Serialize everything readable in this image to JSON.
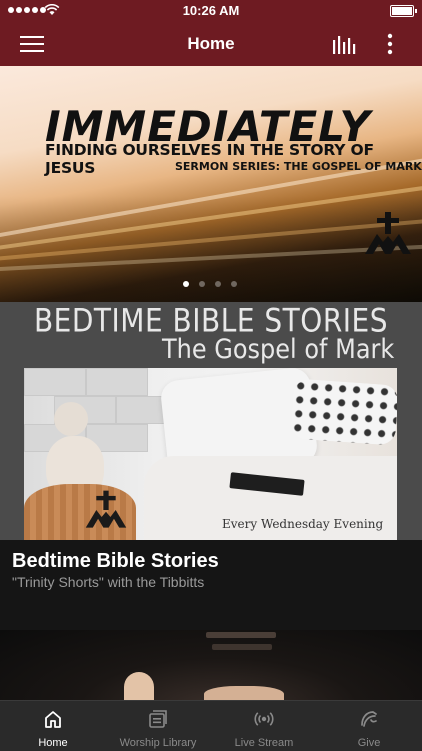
{
  "status_bar": {
    "time": "10:26 AM"
  },
  "nav": {
    "title": "Home"
  },
  "hero": {
    "title": "IMMEDIATELY",
    "subtitle": "FINDING OURSELVES IN THE STORY OF JESUS",
    "series": "SERMON SERIES:  THE GOSPEL OF MARK",
    "page_count": 4,
    "active_page": 1
  },
  "card": {
    "banner_line1": "BEDTIME BIBLE STORIES",
    "banner_line2": "The Gospel of Mark",
    "photo_caption": "Every Wednesday Evening",
    "title": "Bedtime Bible Stories",
    "subtitle": "\"Trinity Shorts\" with the Tibbitts"
  },
  "tabs": [
    {
      "label": "Home",
      "icon": "home-icon",
      "active": true
    },
    {
      "label": "Worship Library",
      "icon": "library-icon",
      "active": false
    },
    {
      "label": "Live Stream",
      "icon": "broadcast-icon",
      "active": false
    },
    {
      "label": "Give",
      "icon": "give-icon",
      "active": false
    }
  ],
  "colors": {
    "brand": "#6e1b22",
    "tab_bar": "#2a2a2a",
    "card_bg": "#4b4b4b"
  }
}
